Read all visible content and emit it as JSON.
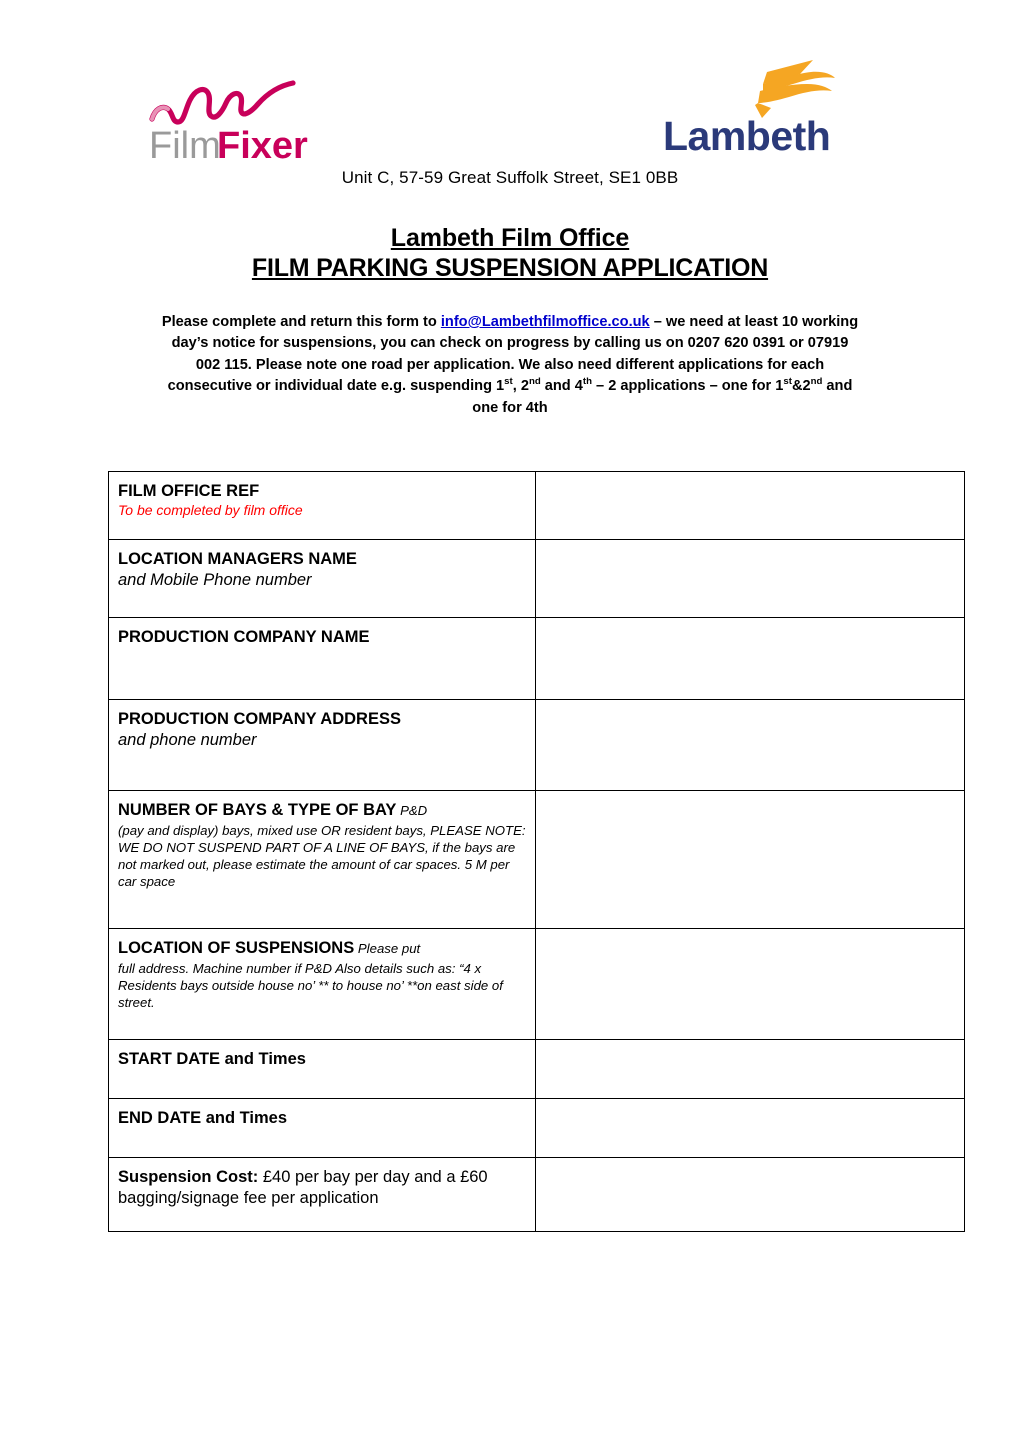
{
  "header": {
    "filmfixer_logo_alt": "FilmFixer",
    "filmfixer_text_light": "Film",
    "filmfixer_text_bold": "Fixer",
    "lambeth_logo_alt": "Lambeth",
    "lambeth_text": "Lambeth",
    "address": "Unit C, 57-59 Great Suffolk Street, SE1 0BB"
  },
  "titles": {
    "main": "Lambeth Film Office",
    "sub": "FILM PARKING SUSPENSION APPLICATION"
  },
  "instructions": {
    "part1": "Please complete and return this form to ",
    "email": "info@Lambethfilmoffice.co.uk",
    "part2": " – we need at least 10 working day’s notice for suspensions, you can check on progress by calling us on 0207 620 0391 or 07919 002 115. Please note one road per application. We also need different applications for each consecutive or individual date e.g. suspending 1",
    "ord1": "st",
    "part3": ", 2",
    "ord2": "nd",
    "part4": " and 4",
    "ord3": "th",
    "part5": " – 2 applications – one for 1",
    "ord4": "st",
    "part6": "&2",
    "ord5": "nd",
    "part7": " and one for 4th"
  },
  "form": {
    "rows": [
      {
        "id": "film-office-ref",
        "label": "FILM OFFICE REF",
        "note_red": "To be completed by film office",
        "value": ""
      },
      {
        "id": "location-managers-name",
        "label": "LOCATION MANAGERS NAME",
        "note_italic": "and Mobile Phone number",
        "value": ""
      },
      {
        "id": "production-company-name",
        "label": "PRODUCTION COMPANY NAME",
        "value": ""
      },
      {
        "id": "production-company-address",
        "label": "PRODUCTION COMPANY ADDRESS",
        "note_italic": "and phone number",
        "value": ""
      },
      {
        "id": "number-of-bays",
        "label": "NUMBER OF BAYS & TYPE OF BAY",
        "inline_note": " P&D",
        "note_small": "(pay and display) bays, mixed use OR resident bays, PLEASE NOTE: WE DO NOT SUSPEND PART OF A LINE OF BAYS, if the bays are not marked out, please estimate the amount of car spaces. 5 M per car space",
        "value": ""
      },
      {
        "id": "location-of-suspensions",
        "label": "LOCATION OF SUSPENSIONS",
        "inline_note": " Please put",
        "note_small": "full address. Machine number if P&D Also details such as: “4 x Residents bays outside house no’ ** to house no’ **on east side of street.",
        "value": ""
      },
      {
        "id": "start-date",
        "label": "START DATE and Times",
        "value": ""
      },
      {
        "id": "end-date",
        "label": "END DATE and Times",
        "value": ""
      },
      {
        "id": "suspension-cost",
        "label_bold": "Suspension Cost:",
        "label_rest": " £40 per bay per day and a £60 bagging/signage fee per application",
        "value": ""
      }
    ]
  },
  "colors": {
    "filmfixer_pink": "#c8005a",
    "filmfixer_grey": "#9a9a9a",
    "lambeth_navy": "#2b3a7a",
    "lambeth_orange": "#f5a623",
    "link_blue": "#0000cc",
    "note_red": "#ff0000",
    "table_border": "#000000"
  }
}
